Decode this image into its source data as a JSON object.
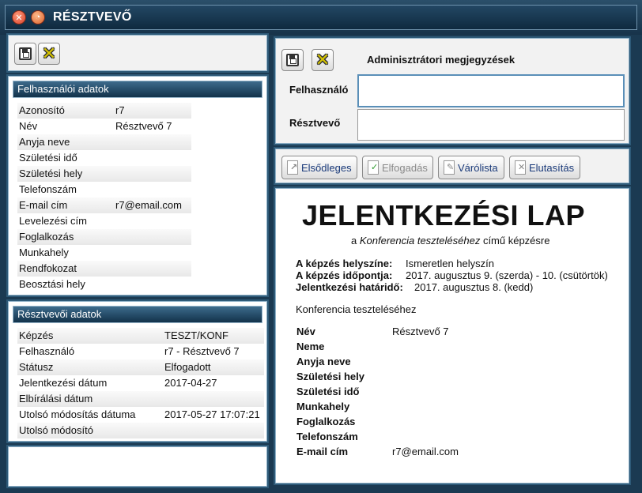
{
  "window": {
    "title": "RÉSZTVEVŐ"
  },
  "user_data": {
    "header": "Felhasználói adatok",
    "rows": [
      {
        "label": "Azonosító",
        "value": "r7"
      },
      {
        "label": "Név",
        "value": "Résztvevő 7"
      },
      {
        "label": "Anyja neve",
        "value": ""
      },
      {
        "label": "Születési idő",
        "value": ""
      },
      {
        "label": "Születési hely",
        "value": ""
      },
      {
        "label": "Telefonszám",
        "value": ""
      },
      {
        "label": "E-mail cím",
        "value": "r7@email.com"
      },
      {
        "label": "Levelezési cím",
        "value": ""
      },
      {
        "label": "Foglalkozás",
        "value": ""
      },
      {
        "label": "Munkahely",
        "value": ""
      },
      {
        "label": "Rendfokozat",
        "value": ""
      },
      {
        "label": "Beosztási hely",
        "value": ""
      }
    ]
  },
  "participant_data": {
    "header": "Résztvevői adatok",
    "rows": [
      {
        "label": "Képzés",
        "value": "TESZT/KONF"
      },
      {
        "label": "Felhasználó",
        "value": "r7 - Résztvevő 7"
      },
      {
        "label": "Státusz",
        "value": "Elfogadott"
      },
      {
        "label": "Jelentkezési dátum",
        "value": "2017-04-27"
      },
      {
        "label": "Elbírálási dátum",
        "value": ""
      },
      {
        "label": "Utolsó módosítás dátuma",
        "value": "2017-05-27 17:07:21"
      },
      {
        "label": "Utolsó módosító",
        "value": ""
      }
    ]
  },
  "admin_notes": {
    "title": "Adminisztrátori megjegyzések",
    "user_label": "Felhasználó",
    "user_value": "",
    "participant_label": "Résztvevő",
    "participant_value": ""
  },
  "actions": {
    "primary": "Elsődleges",
    "accept": "Elfogadás",
    "waitlist": "Várólista",
    "reject": "Elutasítás"
  },
  "application": {
    "title": "JELENTKEZÉSI LAP",
    "subtitle_pre": "a ",
    "subtitle_course": "Konferencia teszteléséhez",
    "subtitle_post": " című képzésre",
    "location_label": "A képzés helyszíne:",
    "location_value": "Ismeretlen helyszín",
    "date_label": "A képzés időpontja:",
    "date_value": "2017. augusztus 9. (szerda) - 10. (csütörtök)",
    "deadline_label": "Jelentkezési határidő:",
    "deadline_value": "2017. augusztus 8. (kedd)",
    "course_name": "Konferencia teszteléséhez",
    "fields": [
      {
        "label": "Név",
        "value": "Résztvevő 7"
      },
      {
        "label": "Neme",
        "value": ""
      },
      {
        "label": "Anyja neve",
        "value": ""
      },
      {
        "label": "Születési hely",
        "value": ""
      },
      {
        "label": "Születési idő",
        "value": ""
      },
      {
        "label": "Munkahely",
        "value": ""
      },
      {
        "label": "Foglalkozás",
        "value": ""
      },
      {
        "label": "Telefonszám",
        "value": ""
      },
      {
        "label": "E-mail cím",
        "value": "r7@email.com"
      }
    ]
  }
}
